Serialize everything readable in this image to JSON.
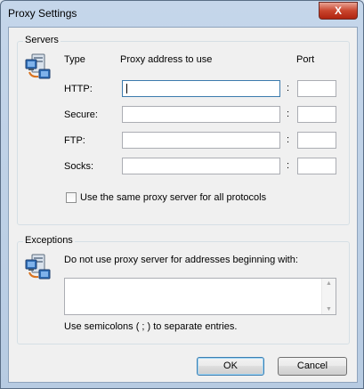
{
  "window": {
    "title": "Proxy Settings",
    "close_label": "X"
  },
  "servers": {
    "group_label": "Servers",
    "headers": {
      "type": "Type",
      "address": "Proxy address to use",
      "port": "Port"
    },
    "rows": [
      {
        "label": "HTTP:",
        "address": "",
        "port": ""
      },
      {
        "label": "Secure:",
        "address": "",
        "port": ""
      },
      {
        "label": "FTP:",
        "address": "",
        "port": ""
      },
      {
        "label": "Socks:",
        "address": "",
        "port": ""
      }
    ],
    "separator": ":",
    "same_proxy": {
      "label": "Use the same proxy server for all protocols",
      "checked": false
    }
  },
  "exceptions": {
    "group_label": "Exceptions",
    "description": "Do not use proxy server for addresses beginning with:",
    "value": "",
    "hint": "Use semicolons ( ; ) to separate entries."
  },
  "buttons": {
    "ok": "OK",
    "cancel": "Cancel"
  },
  "icons": {
    "servers": "network-computer-icon",
    "exceptions": "network-computer-icon"
  }
}
